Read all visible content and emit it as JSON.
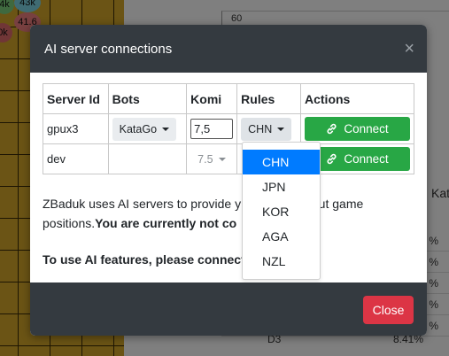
{
  "background": {
    "stones": [
      "4k",
      "43k",
      "41.6",
      "0k"
    ],
    "chart_tick": "60",
    "table_fragment": {
      "col_label": "Katι",
      "rows": [
        "%",
        "%",
        "%",
        "%",
        "%",
        "%"
      ],
      "last_label": "D3",
      "last_value": "8.41%"
    }
  },
  "modal": {
    "title": "AI server connections",
    "close_glyph": "×",
    "table": {
      "headers": [
        "Server Id",
        "Bots",
        "Komi",
        "Rules",
        "Actions"
      ],
      "rows": [
        {
          "server_id": "gpux3",
          "bot": "KataGo",
          "komi": "7,5",
          "rules": "CHN",
          "action": "Connect"
        },
        {
          "server_id": "dev",
          "bot": "",
          "komi": "7.5",
          "rules": "",
          "action": "Connect"
        }
      ]
    },
    "description_start": "ZBaduk uses AI servers to provide y",
    "description_end": "bout game",
    "description_line2": "positions.",
    "description_bold": "You are currently not co",
    "instruction": "To use AI features, please connect",
    "footer": {
      "close_label": "Close"
    }
  },
  "rules_dropdown": {
    "options": [
      "CHN",
      "JPN",
      "KOR",
      "AGA",
      "NZL"
    ],
    "selected": "CHN"
  },
  "colors": {
    "header_bg": "#343a40",
    "connect_green": "#28a745",
    "close_red": "#dc3545",
    "dropdown_active": "#007bff",
    "board_yellow": "#d7a92b"
  }
}
